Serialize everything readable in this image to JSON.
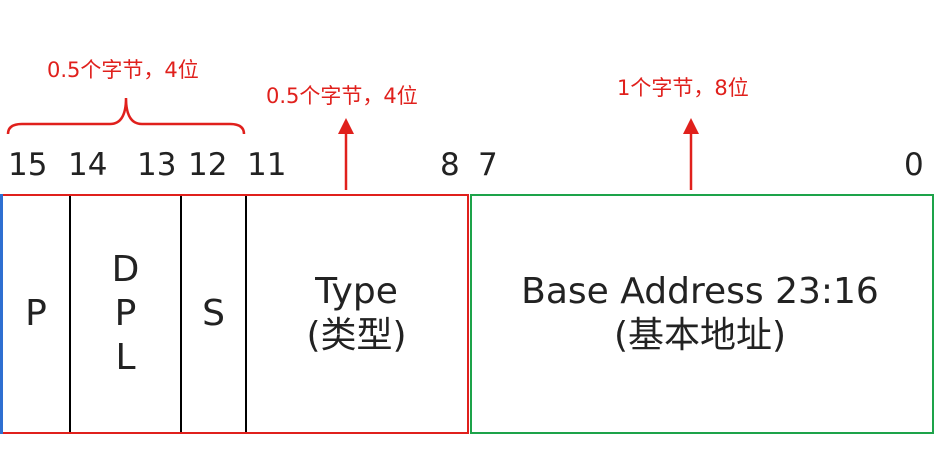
{
  "annotations": [
    {
      "text": "0.5个字节，4位"
    },
    {
      "text": "0.5个字节，4位"
    },
    {
      "text": "1个字节，8位"
    }
  ],
  "bit_labels": [
    "15",
    "14",
    "13",
    "12",
    "11",
    "8",
    "7",
    "0"
  ],
  "fields": {
    "p": {
      "label": "P"
    },
    "dpl": {
      "letters": [
        "D",
        "P",
        "L"
      ]
    },
    "s": {
      "label": "S"
    },
    "type": {
      "line1": "Type",
      "line2": "(类型)"
    },
    "base": {
      "line1": "Base Address 23:16",
      "line2": "(基本地址)"
    }
  },
  "colors": {
    "annotation": "#e0201c",
    "red_box": "#e0201c",
    "green_box": "#1da34a",
    "blue_edge": "#2f6fd1",
    "text": "#222222",
    "divider": "#000000"
  }
}
